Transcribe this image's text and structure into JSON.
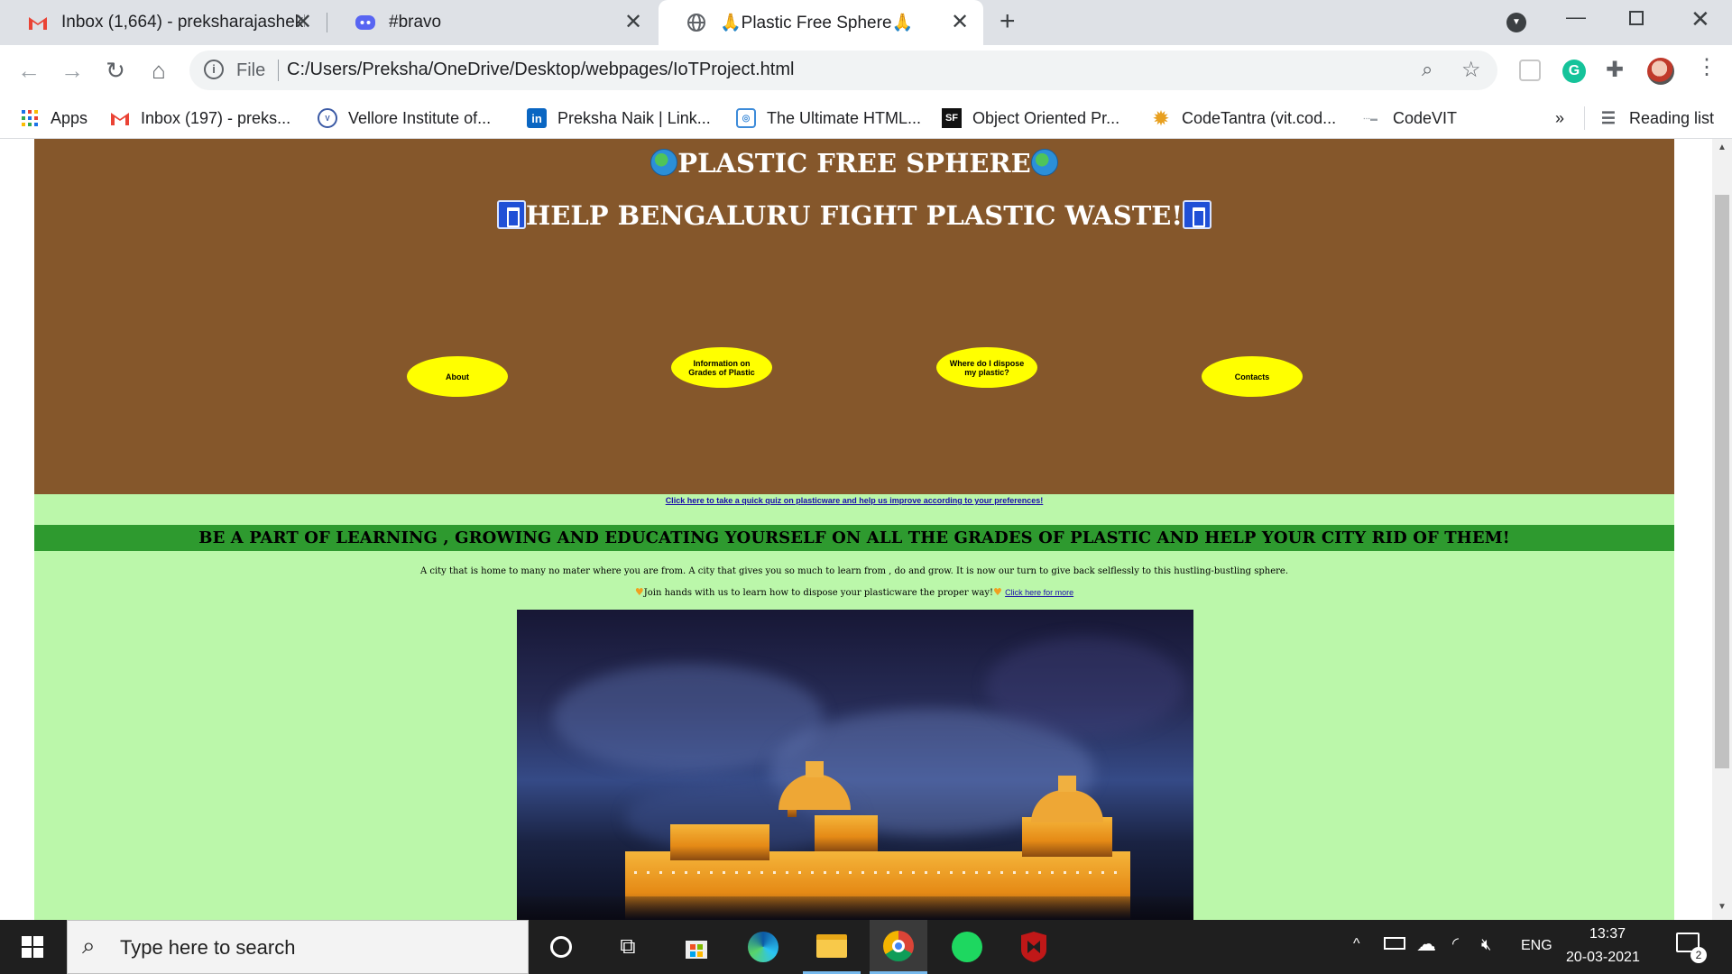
{
  "browser": {
    "tabs": [
      {
        "title": "Inbox (1,664) - preksharajashekh",
        "icon": "gmail-icon",
        "active": false
      },
      {
        "title": "#bravo",
        "icon": "discord-icon",
        "active": false
      },
      {
        "title": "🙏Plastic Free Sphere🙏",
        "icon": "globe-icon",
        "active": true
      }
    ],
    "new_tab": "+",
    "address": {
      "scheme": "File",
      "url": "C:/Users/Preksha/OneDrive/Desktop/webpages/IoTProject.html"
    },
    "bookmarks": [
      {
        "label": "Apps",
        "icon": "apps-grid-icon"
      },
      {
        "label": "Inbox (197) - preks...",
        "icon": "gmail-icon"
      },
      {
        "label": "Vellore Institute of...",
        "icon": "vit-icon"
      },
      {
        "label": "Preksha Naik | Link...",
        "icon": "linkedin-icon"
      },
      {
        "label": "The Ultimate HTML...",
        "icon": "html-icon"
      },
      {
        "label": "Object Oriented Pr...",
        "icon": "sf-icon"
      },
      {
        "label": "CodeTantra (vit.cod...",
        "icon": "codetantra-icon"
      },
      {
        "label": "CodeVIT",
        "icon": "codevit-icon"
      }
    ],
    "more_bookmarks": "»",
    "reading_list": "Reading list"
  },
  "page": {
    "title": "PLASTIC FREE SPHERE",
    "subtitle": "HELP BENGALURU FIGHT PLASTIC WASTE!",
    "nav": [
      {
        "label": "About"
      },
      {
        "label": "Information on Grades of Plastic"
      },
      {
        "label": "Where do I dispose my plastic?"
      },
      {
        "label": "Contacts"
      }
    ],
    "quiz_link": "Click here to take a quick quiz on plasticware and help us improve according to your preferences!",
    "banner": "BE A PART OF LEARNING , GROWING AND EDUCATING YOURSELF ON ALL THE GRADES OF PLASTIC AND HELP YOUR CITY RID OF THEM!",
    "intro": "A city that is home to many no mater where you are from. A city that gives you so much to learn from , do and grow. It is now our turn to give back selflessly to this hustling-bustling sphere.",
    "join_text": "Join hands with us to learn how to dispose your plasticware the proper way!",
    "join_link": "Click here for more",
    "colors": {
      "hero": "#85572b",
      "background": "#bbf7aa",
      "banner": "#2e9a2f",
      "button": "#ffff00"
    }
  },
  "taskbar": {
    "search_placeholder": "Type here to search",
    "apps": [
      "cortana-icon",
      "task-view-icon",
      "store-icon",
      "edge-icon",
      "file-explorer-icon",
      "chrome-icon",
      "spotify-icon",
      "mcafee-icon"
    ],
    "language": "ENG",
    "time": "13:37",
    "date": "20-03-2021",
    "notifications": "2"
  }
}
